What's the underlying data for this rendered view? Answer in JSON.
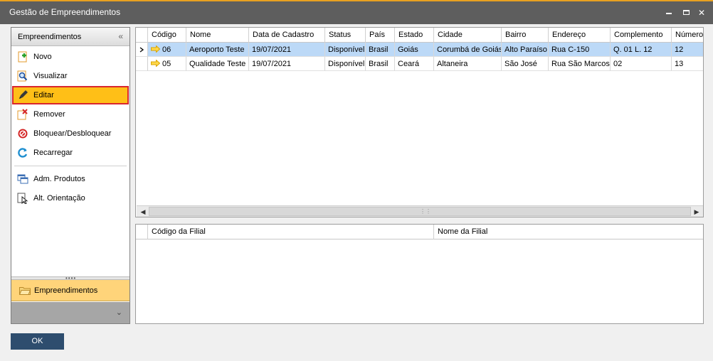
{
  "window": {
    "title": "Gestão de Empreendimentos"
  },
  "sidebar": {
    "header": "Empreendimentos",
    "items": [
      {
        "label": "Novo",
        "icon": "new-document-icon"
      },
      {
        "label": "Visualizar",
        "icon": "magnifier-icon"
      },
      {
        "label": "Editar",
        "icon": "pencil-icon"
      },
      {
        "label": "Remover",
        "icon": "remove-document-icon"
      },
      {
        "label": "Bloquear/Desbloquear",
        "icon": "block-icon"
      },
      {
        "label": "Recarregar",
        "icon": "reload-icon"
      },
      {
        "label": "Adm. Produtos",
        "icon": "windows-icon"
      },
      {
        "label": "Alt. Orientação",
        "icon": "document-cursor-icon"
      }
    ],
    "active_index": 2,
    "folder": "Empreendimentos"
  },
  "grid": {
    "columns": [
      "Código",
      "Nome",
      "Data de Cadastro",
      "Status",
      "País",
      "Estado",
      "Cidade",
      "Bairro",
      "Endereço",
      "Complemento",
      "Número"
    ],
    "rows": [
      [
        "06",
        "Aeroporto Teste",
        "19/07/2021",
        "Disponível",
        "Brasil",
        "Goiás",
        "Corumbá de Goiás",
        "Alto Paraíso",
        "Rua C-150",
        "Q. 01 L. 12",
        "12"
      ],
      [
        "05",
        "Qualidade Teste",
        "19/07/2021",
        "Disponível",
        "Brasil",
        "Ceará",
        "Altaneira",
        "São José",
        "Rua São Marcos",
        "02",
        "13"
      ]
    ],
    "selected_row": 0
  },
  "subgrid": {
    "columns": [
      "Código da Filial",
      "Nome da Filial"
    ]
  },
  "footer": {
    "ok_label": "OK"
  },
  "colors": {
    "titlebar": "#5e5e5e",
    "accent": "#e8a020",
    "active_item": "#ffbf17",
    "active_border": "#d9262e",
    "selected_row": "#bcd9f7",
    "ok_button": "#2e4d6e"
  }
}
